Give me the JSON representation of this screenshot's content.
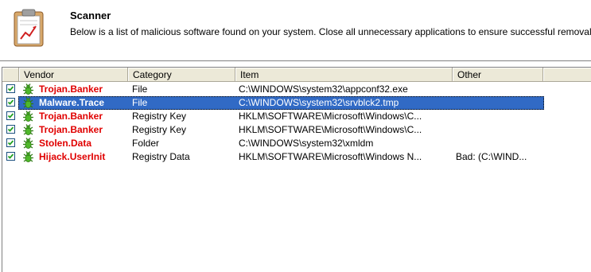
{
  "header": {
    "title": "Scanner",
    "description": "Below is a list of malicious software found on your system. Close all unnecessary applications to ensure successful removal."
  },
  "columns": {
    "check": "",
    "vendor": "Vendor",
    "category": "Category",
    "item": "Item",
    "other": "Other"
  },
  "rows": [
    {
      "vendor": "Trojan.Banker",
      "category": "File",
      "item": "C:\\WINDOWS\\system32\\appconf32.exe",
      "other": "",
      "checked": true,
      "selected": false
    },
    {
      "vendor": "Malware.Trace",
      "category": "File",
      "item": "C:\\WINDOWS\\system32\\srvblck2.tmp",
      "other": "",
      "checked": true,
      "selected": true
    },
    {
      "vendor": "Trojan.Banker",
      "category": "Registry Key",
      "item": "HKLM\\SOFTWARE\\Microsoft\\Windows\\C...",
      "other": "",
      "checked": true,
      "selected": false
    },
    {
      "vendor": "Trojan.Banker",
      "category": "Registry Key",
      "item": "HKLM\\SOFTWARE\\Microsoft\\Windows\\C...",
      "other": "",
      "checked": true,
      "selected": false
    },
    {
      "vendor": "Stolen.Data",
      "category": "Folder",
      "item": "C:\\WINDOWS\\system32\\xmldm",
      "other": "",
      "checked": true,
      "selected": false
    },
    {
      "vendor": "Hijack.UserInit",
      "category": "Registry Data",
      "item": "HKLM\\SOFTWARE\\Microsoft\\Windows N...",
      "other": "Bad: (C:\\WIND...",
      "checked": true,
      "selected": false
    }
  ],
  "colors": {
    "vendor_text": "#e00000",
    "selection": "#316ac5",
    "header_bg": "#ece9d8"
  }
}
